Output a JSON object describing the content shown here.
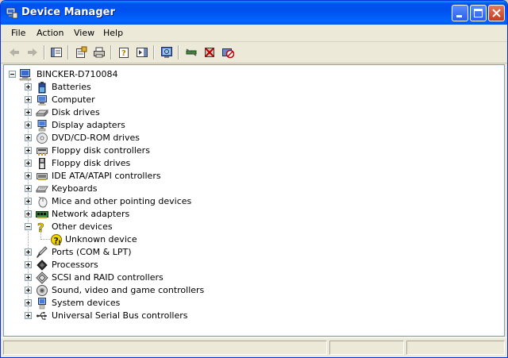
{
  "window": {
    "title": "Device Manager"
  },
  "menu": {
    "items": [
      "File",
      "Action",
      "View",
      "Help"
    ]
  },
  "toolbar": {
    "buttons": [
      "back-icon",
      "forward-icon",
      "show-hide-tree-icon",
      "properties-icon",
      "print-icon",
      "help-icon",
      "show-hide-action-pane-icon",
      "scan-hardware-icon",
      "update-driver-icon",
      "uninstall-icon",
      "disable-icon"
    ]
  },
  "tree": {
    "root": "BINCKER-D710084",
    "categories": [
      {
        "label": "Batteries",
        "icon": "battery-icon",
        "expanded": false
      },
      {
        "label": "Computer",
        "icon": "computer-icon",
        "expanded": false
      },
      {
        "label": "Disk drives",
        "icon": "disk-drive-icon",
        "expanded": false
      },
      {
        "label": "Display adapters",
        "icon": "display-adapter-icon",
        "expanded": false
      },
      {
        "label": "DVD/CD-ROM drives",
        "icon": "cdrom-icon",
        "expanded": false
      },
      {
        "label": "Floppy disk controllers",
        "icon": "floppy-controller-icon",
        "expanded": false
      },
      {
        "label": "Floppy disk drives",
        "icon": "floppy-drive-icon",
        "expanded": false
      },
      {
        "label": "IDE ATA/ATAPI controllers",
        "icon": "ide-controller-icon",
        "expanded": false
      },
      {
        "label": "Keyboards",
        "icon": "keyboard-icon",
        "expanded": false
      },
      {
        "label": "Mice and other pointing devices",
        "icon": "mouse-icon",
        "expanded": false
      },
      {
        "label": "Network adapters",
        "icon": "network-adapter-icon",
        "expanded": false
      },
      {
        "label": "Other devices",
        "icon": "question-icon",
        "expanded": true,
        "children": [
          {
            "label": "Unknown device",
            "icon": "unknown-device-icon"
          }
        ]
      },
      {
        "label": "Ports (COM & LPT)",
        "icon": "port-icon",
        "expanded": false
      },
      {
        "label": "Processors",
        "icon": "processor-icon",
        "expanded": false
      },
      {
        "label": "SCSI and RAID controllers",
        "icon": "scsi-icon",
        "expanded": false
      },
      {
        "label": "Sound, video and game controllers",
        "icon": "sound-icon",
        "expanded": false
      },
      {
        "label": "System devices",
        "icon": "system-devices-icon",
        "expanded": false
      },
      {
        "label": "Universal Serial Bus controllers",
        "icon": "usb-icon",
        "expanded": false
      }
    ]
  },
  "colors": {
    "titlebar": "#0054e3",
    "window_bg": "#ece9d8",
    "client_bg": "#ffffff"
  }
}
